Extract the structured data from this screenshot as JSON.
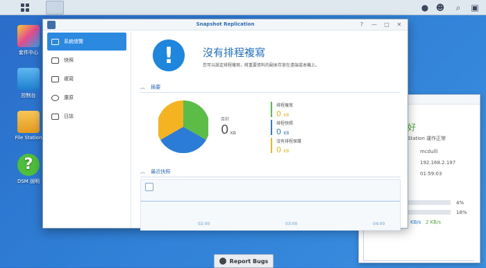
{
  "desktop": {
    "icons": [
      {
        "label": "套件中心",
        "icon": "package-center-icon"
      },
      {
        "label": "控制台",
        "icon": "control-panel-icon"
      },
      {
        "label": "File Station",
        "icon": "file-station-icon"
      },
      {
        "label": "DSM 說明",
        "icon": "help-icon"
      }
    ]
  },
  "window": {
    "title": "Snapshot Replication",
    "sidebar": [
      {
        "label": "系統總覽",
        "icon": "overview-icon",
        "active": true
      },
      {
        "label": "快照",
        "icon": "camera-icon"
      },
      {
        "label": "複寫",
        "icon": "replication-icon"
      },
      {
        "label": "還原",
        "icon": "restore-icon"
      },
      {
        "label": "日誌",
        "icon": "log-icon"
      }
    ],
    "status": {
      "title": "沒有排程複寫",
      "description": "您可以設定排程複寫，將重要資料的副本存放在遠端或本機上。"
    },
    "summary": {
      "heading": "摘要",
      "total_label": "合計",
      "total_value": "0",
      "total_unit": "KB",
      "items": [
        {
          "label": "排程複寫",
          "value": "0",
          "unit": "KB",
          "color": "#5bbd45"
        },
        {
          "label": "排程快照",
          "value": "0",
          "unit": "KB",
          "color": "#2b7cd6"
        },
        {
          "label": "沒有排程保護",
          "value": "0",
          "unit": "KB",
          "color": "#f4b321"
        }
      ]
    },
    "recent": {
      "heading": "最近快照",
      "ticks": [
        "02:00",
        "03:00",
        "04:00"
      ]
    }
  },
  "widget": {
    "status_suffix": "好",
    "status_line": "Station 運作正常",
    "hostname": "mcdulll",
    "ip": "192.168.2.197",
    "uptime": "01:59:03",
    "cpu": "4%",
    "ram": "18%",
    "upload": "KB/s",
    "download": "2 KB/s"
  },
  "report_bugs": "Report Bugs",
  "colors": {
    "accent": "#2b8ae0",
    "green": "#5bbd45",
    "blue": "#2b7cd6",
    "yellow": "#f4b321"
  }
}
